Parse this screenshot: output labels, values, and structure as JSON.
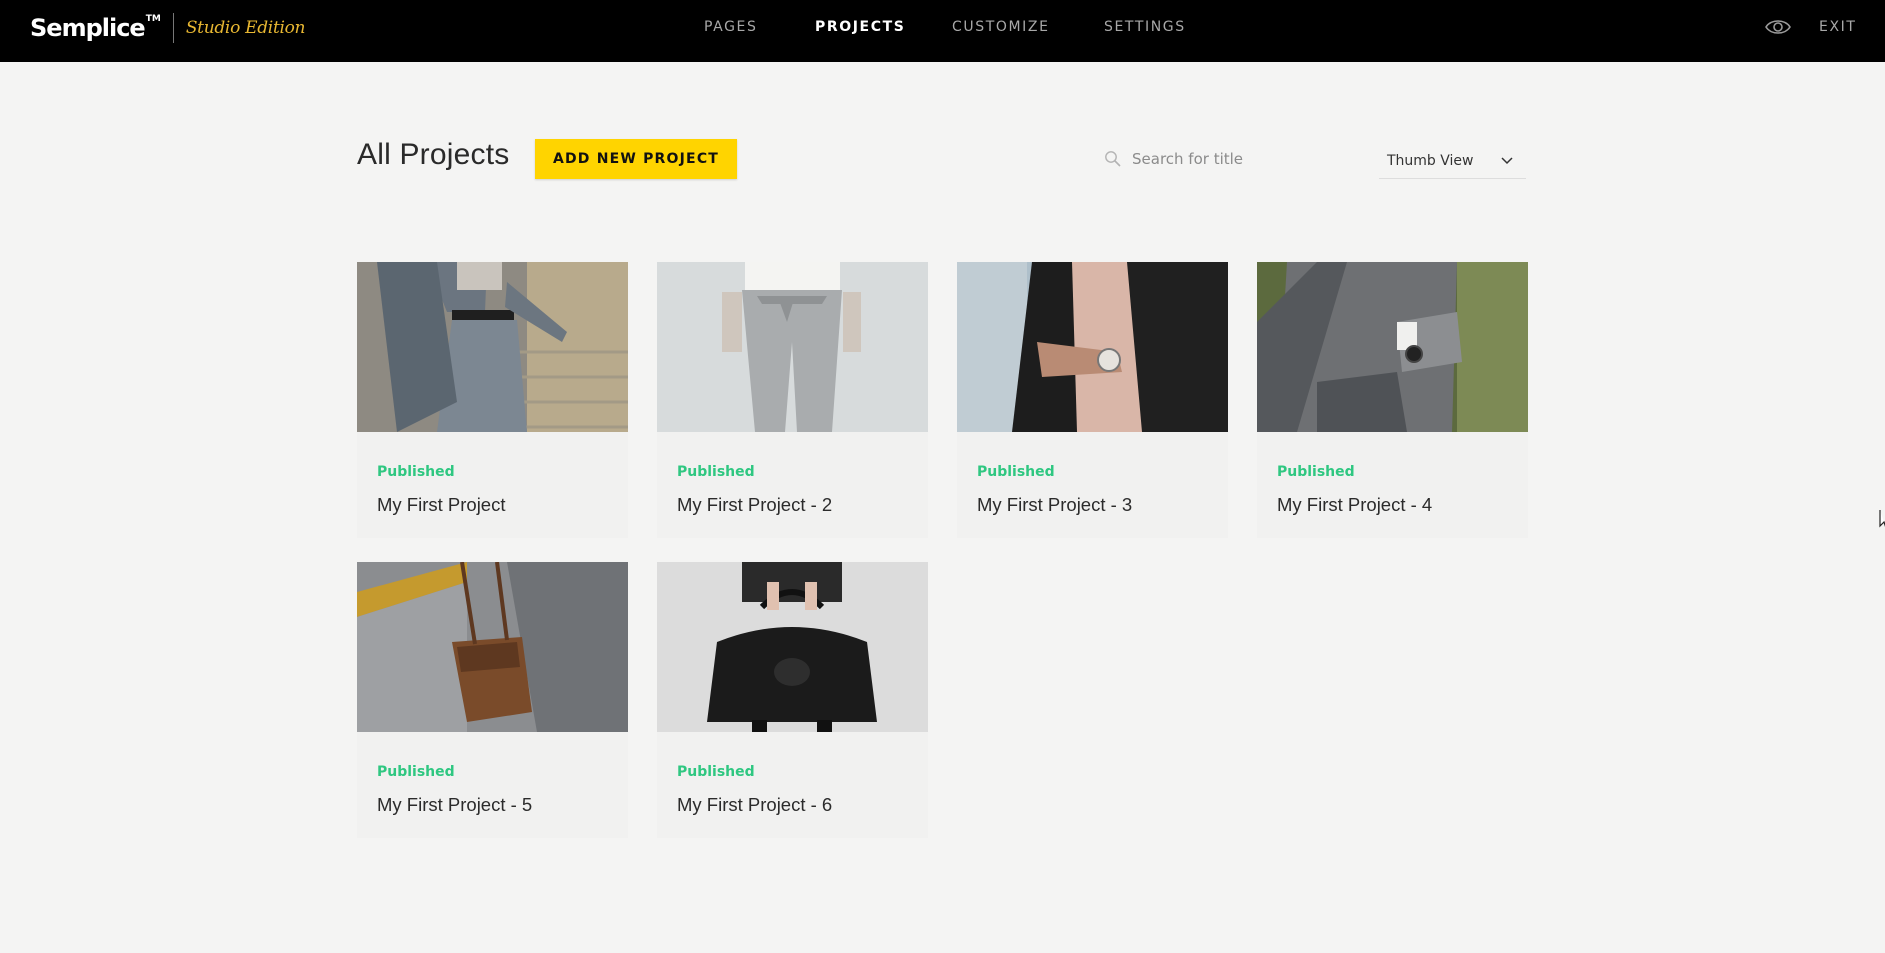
{
  "brand": {
    "name": "Semplice",
    "tm": "TM",
    "edition": "Studio Edition"
  },
  "nav": [
    {
      "label": "PAGES",
      "active": false
    },
    {
      "label": "PROJECTS",
      "active": true
    },
    {
      "label": "CUSTOMIZE",
      "active": false
    },
    {
      "label": "SETTINGS",
      "active": false
    }
  ],
  "header_actions": {
    "preview_icon": "eye-icon",
    "exit_label": "EXIT"
  },
  "main": {
    "title": "All Projects",
    "add_button_label": "ADD NEW PROJECT",
    "search": {
      "placeholder": "Search for title",
      "value": "",
      "icon": "search-icon"
    },
    "view_select": {
      "selected": "Thumb View",
      "icon": "chevron-down-icon"
    }
  },
  "projects": [
    {
      "status": "Published",
      "title": "My First Project"
    },
    {
      "status": "Published",
      "title": "My First Project - 2"
    },
    {
      "status": "Published",
      "title": "My First Project - 3"
    },
    {
      "status": "Published",
      "title": "My First Project - 4"
    },
    {
      "status": "Published",
      "title": "My First Project - 5"
    },
    {
      "status": "Published",
      "title": "My First Project - 6"
    }
  ],
  "colors": {
    "topbar": "#000000",
    "accent_button": "#ffd400",
    "published": "#2fc781",
    "edition": "#e9b832",
    "background": "#f4f4f3"
  }
}
